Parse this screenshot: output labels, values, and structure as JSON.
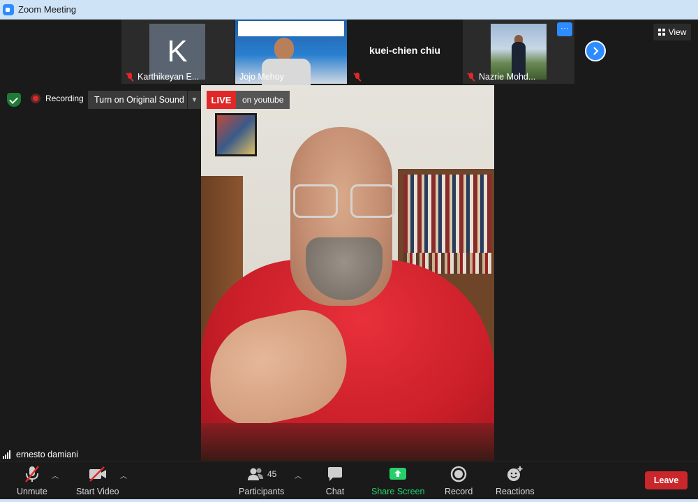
{
  "window": {
    "title": "Zoom Meeting"
  },
  "thumbnails": [
    {
      "name": "Karthikeyan E...",
      "initial": "K",
      "muted": true
    },
    {
      "name": "Jojo Mehoy",
      "muted": false
    },
    {
      "name": "kuei-chien chiu",
      "muted": true
    },
    {
      "name": "Nazrie Mohd...",
      "muted": true
    }
  ],
  "strip": {
    "more_label": "···"
  },
  "view": {
    "label": "View"
  },
  "status": {
    "recording_label": "Recording",
    "original_sound_label": "Turn on Original Sound",
    "live_label": "LIVE",
    "live_target": "on youtube"
  },
  "main_video": {
    "speaker_name": "ernesto damiani"
  },
  "toolbar": {
    "unmute_label": "Unmute",
    "start_video_label": "Start Video",
    "participants_label": "Participants",
    "participants_count": "45",
    "chat_label": "Chat",
    "share_label": "Share Screen",
    "record_label": "Record",
    "reactions_label": "Reactions",
    "leave_label": "Leave"
  },
  "colors": {
    "accent": "#2d8cff",
    "danger": "#e02828",
    "share": "#25d06a",
    "leave": "#c9272b"
  }
}
